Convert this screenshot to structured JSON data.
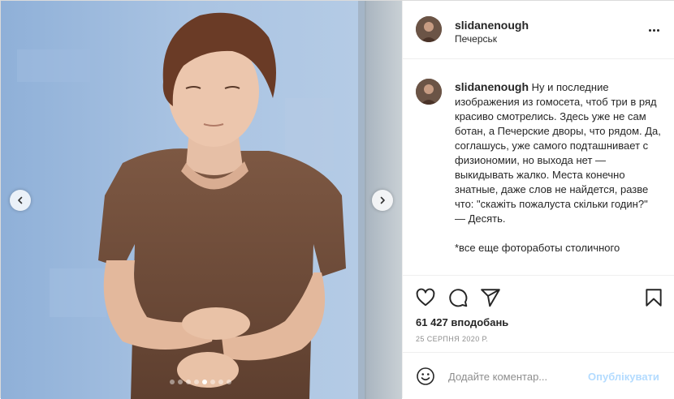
{
  "post": {
    "username": "slidanenough",
    "location": "Печерськ",
    "caption": "Ну и последние изображения из гомосета, чтоб три в ряд красиво смотрелись. Здесь уже не сам ботан, а Печерские дворы, что рядом. Да, соглашусь, уже самого подташнивает с физиономии, но выхода нет — выкидывать жалко. Места конечно знатные, даже слов не найдется, разве что: \"скажіть пожалуста скільки годин?\"\n— Десять.\n\n*все еще фоторaботы столичного",
    "likes": "61 427 вподобань",
    "date": "25 СЕРПНЯ 2020 Р.",
    "carousel": {
      "total": 8,
      "active": 5
    }
  },
  "comment": {
    "placeholder": "Додайте коментар...",
    "post_label": "Опублікувати"
  },
  "icons": {
    "more": "more-options-icon",
    "heart": "heart-icon",
    "comment": "comment-icon",
    "share": "share-icon",
    "save": "bookmark-icon",
    "emoji": "emoji-icon",
    "prev": "chevron-left-icon",
    "next": "chevron-right-icon"
  },
  "colors": {
    "post_button": "#b3dbff",
    "muted_text": "#8e8e8e",
    "text": "#262626",
    "divider": "#efefef"
  }
}
